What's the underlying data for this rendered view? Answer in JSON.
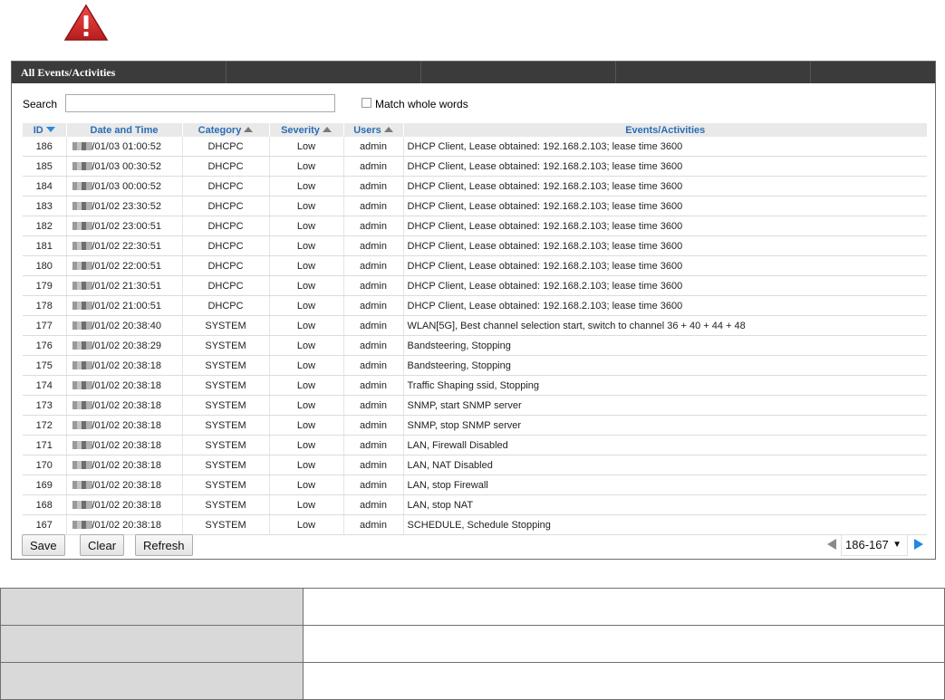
{
  "panel": {
    "title": "All Events/Activities"
  },
  "search": {
    "label": "Search",
    "value": "",
    "placeholder": "",
    "match_whole_words_label": "Match whole words",
    "match_whole_words_checked": false
  },
  "table": {
    "columns": [
      {
        "label": "ID",
        "sort": "desc"
      },
      {
        "label": "Date and Time",
        "sort": "none"
      },
      {
        "label": "Category",
        "sort": "asc"
      },
      {
        "label": "Severity",
        "sort": "asc"
      },
      {
        "label": "Users",
        "sort": "asc"
      },
      {
        "label": "Events/Activities",
        "sort": "none"
      }
    ],
    "rows": [
      {
        "id": "186",
        "datetime": "/01/03 01:00:52",
        "category": "DHCPC",
        "severity": "Low",
        "user": "admin",
        "event": "DHCP Client, Lease obtained: 192.168.2.103; lease time 3600"
      },
      {
        "id": "185",
        "datetime": "/01/03 00:30:52",
        "category": "DHCPC",
        "severity": "Low",
        "user": "admin",
        "event": "DHCP Client, Lease obtained: 192.168.2.103; lease time 3600"
      },
      {
        "id": "184",
        "datetime": "/01/03 00:00:52",
        "category": "DHCPC",
        "severity": "Low",
        "user": "admin",
        "event": "DHCP Client, Lease obtained: 192.168.2.103; lease time 3600"
      },
      {
        "id": "183",
        "datetime": "/01/02 23:30:52",
        "category": "DHCPC",
        "severity": "Low",
        "user": "admin",
        "event": "DHCP Client, Lease obtained: 192.168.2.103; lease time 3600"
      },
      {
        "id": "182",
        "datetime": "/01/02 23:00:51",
        "category": "DHCPC",
        "severity": "Low",
        "user": "admin",
        "event": "DHCP Client, Lease obtained: 192.168.2.103; lease time 3600"
      },
      {
        "id": "181",
        "datetime": "/01/02 22:30:51",
        "category": "DHCPC",
        "severity": "Low",
        "user": "admin",
        "event": "DHCP Client, Lease obtained: 192.168.2.103; lease time 3600"
      },
      {
        "id": "180",
        "datetime": "/01/02 22:00:51",
        "category": "DHCPC",
        "severity": "Low",
        "user": "admin",
        "event": "DHCP Client, Lease obtained: 192.168.2.103; lease time 3600"
      },
      {
        "id": "179",
        "datetime": "/01/02 21:30:51",
        "category": "DHCPC",
        "severity": "Low",
        "user": "admin",
        "event": "DHCP Client, Lease obtained: 192.168.2.103; lease time 3600"
      },
      {
        "id": "178",
        "datetime": "/01/02 21:00:51",
        "category": "DHCPC",
        "severity": "Low",
        "user": "admin",
        "event": "DHCP Client, Lease obtained: 192.168.2.103; lease time 3600"
      },
      {
        "id": "177",
        "datetime": "/01/02 20:38:40",
        "category": "SYSTEM",
        "severity": "Low",
        "user": "admin",
        "event": "WLAN[5G], Best channel selection start, switch to channel 36 + 40 + 44 + 48"
      },
      {
        "id": "176",
        "datetime": "/01/02 20:38:29",
        "category": "SYSTEM",
        "severity": "Low",
        "user": "admin",
        "event": "Bandsteering, Stopping"
      },
      {
        "id": "175",
        "datetime": "/01/02 20:38:18",
        "category": "SYSTEM",
        "severity": "Low",
        "user": "admin",
        "event": "Bandsteering, Stopping"
      },
      {
        "id": "174",
        "datetime": "/01/02 20:38:18",
        "category": "SYSTEM",
        "severity": "Low",
        "user": "admin",
        "event": "Traffic Shaping ssid, Stopping"
      },
      {
        "id": "173",
        "datetime": "/01/02 20:38:18",
        "category": "SYSTEM",
        "severity": "Low",
        "user": "admin",
        "event": "SNMP, start SNMP server"
      },
      {
        "id": "172",
        "datetime": "/01/02 20:38:18",
        "category": "SYSTEM",
        "severity": "Low",
        "user": "admin",
        "event": "SNMP, stop SNMP server"
      },
      {
        "id": "171",
        "datetime": "/01/02 20:38:18",
        "category": "SYSTEM",
        "severity": "Low",
        "user": "admin",
        "event": "LAN, Firewall Disabled"
      },
      {
        "id": "170",
        "datetime": "/01/02 20:38:18",
        "category": "SYSTEM",
        "severity": "Low",
        "user": "admin",
        "event": "LAN, NAT Disabled"
      },
      {
        "id": "169",
        "datetime": "/01/02 20:38:18",
        "category": "SYSTEM",
        "severity": "Low",
        "user": "admin",
        "event": "LAN, stop Firewall"
      },
      {
        "id": "168",
        "datetime": "/01/02 20:38:18",
        "category": "SYSTEM",
        "severity": "Low",
        "user": "admin",
        "event": "LAN, stop NAT"
      },
      {
        "id": "167",
        "datetime": "/01/02 20:38:18",
        "category": "SYSTEM",
        "severity": "Low",
        "user": "admin",
        "event": "SCHEDULE, Schedule Stopping"
      }
    ]
  },
  "buttons": {
    "save": "Save",
    "clear": "Clear",
    "refresh": "Refresh"
  },
  "pager": {
    "selected": "186-167",
    "caret": "▼"
  },
  "colors": {
    "header_bg": "#3b3b3b",
    "column_header_text": "#2a6db5",
    "sort_arrow_active": "#2a8ad8",
    "next_arrow": "#1e88e5",
    "warning_red": "#d32f2f",
    "desc_key_bg": "#d9d9d9"
  },
  "icons": {
    "warning": "warning-triangle-icon"
  }
}
